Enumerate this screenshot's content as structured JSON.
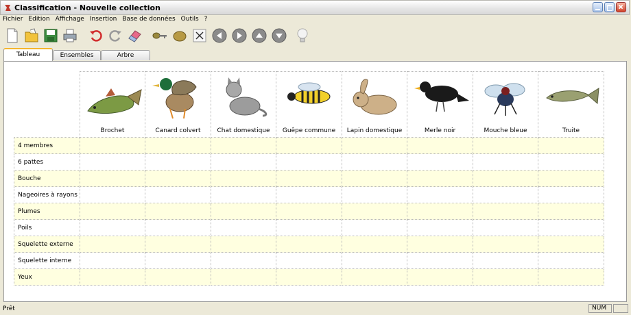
{
  "window": {
    "title": "Classification - Nouvelle collection"
  },
  "menu": [
    "Fichier",
    "Edition",
    "Affichage",
    "Insertion",
    "Base de données",
    "Outils",
    "?"
  ],
  "toolbar": [
    "new-document-icon",
    "open-folder-icon",
    "save-icon",
    "print-icon",
    "undo-icon",
    "redo-icon",
    "eraser-icon",
    "key-icon",
    "seed-icon",
    "delete-x-icon",
    "arrow-left-icon",
    "arrow-right-icon",
    "arrow-up-icon",
    "arrow-down-icon",
    "lightbulb-icon"
  ],
  "tabs": [
    "Tableau",
    "Ensembles",
    "Arbre"
  ],
  "active_tab": "Tableau",
  "table": {
    "columns": [
      "Brochet",
      "Canard colvert",
      "Chat domestique",
      "Guêpe commune",
      "Lapin domestique",
      "Merle noir",
      "Mouche bleue",
      "Truite"
    ],
    "column_images": [
      "pike-fish-image",
      "mallard-duck-image",
      "cat-image",
      "wasp-image",
      "rabbit-image",
      "blackbird-image",
      "blue-fly-image",
      "trout-image"
    ],
    "rows": [
      "4 membres",
      "6 pattes",
      "Bouche",
      "Nageoires à rayons",
      "Plumes",
      "Poils",
      "Squelette externe",
      "Squelette interne",
      "Yeux"
    ],
    "row_highlight_color": "#ffffe0"
  },
  "status": {
    "text": "Prêt",
    "num": "NUM"
  }
}
